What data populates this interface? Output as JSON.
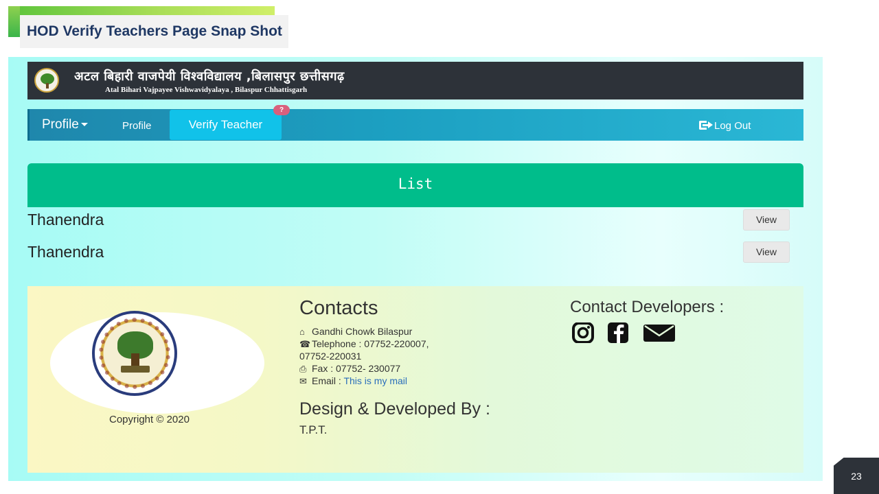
{
  "slide": {
    "title": "HOD Verify Teachers Page Snap Shot",
    "page_number": "23"
  },
  "university": {
    "name_hindi": "अटल बिहारी वाजपेयी विश्वविद्यालय ,बिलासपुर छत्तीसगढ़",
    "name_english": "Atal Bihari Vajpayee Vishwavidyalaya , Bilaspur Chhattisgarh"
  },
  "navbar": {
    "brand": "Profile",
    "profile_link": "Profile",
    "verify_link": "Verify Teacher",
    "badge": "?",
    "logout": "Log Out"
  },
  "list": {
    "header": "List",
    "items": [
      {
        "name": "Thanendra",
        "action": "View"
      },
      {
        "name": "Thanendra",
        "action": "View"
      }
    ]
  },
  "footer": {
    "copyright": "Copyright © 2020",
    "contacts_title": "Contacts",
    "address": "Gandhi Chowk Bilaspur",
    "telephone_label": "Telephone : ",
    "telephone_1": "07752-220007,",
    "telephone_2": "07752-220031",
    "fax": "Fax : 07752- 230077",
    "email_label": "Email : ",
    "email_link": "This is my mail",
    "design_title": "Design & Developed By :",
    "design_name": "T.P.T.",
    "developers_title": "Contact Developers :"
  },
  "icons": {
    "logo": "university-emblem",
    "home": "home-icon",
    "phone": "phone-icon",
    "fax": "fax-icon",
    "envelope": "envelope-icon",
    "instagram": "instagram-icon",
    "facebook": "facebook-icon",
    "logout": "sign-out-icon"
  },
  "colors": {
    "slide_title": "#1f3864",
    "header_bg": "#2d3239",
    "navbar_start": "#1f87ac",
    "navbar_end": "#2ab7d5",
    "active_tab": "#11c2e9",
    "badge": "#d9607d",
    "list_header": "#00bd8b",
    "link": "#2a6ebb"
  }
}
